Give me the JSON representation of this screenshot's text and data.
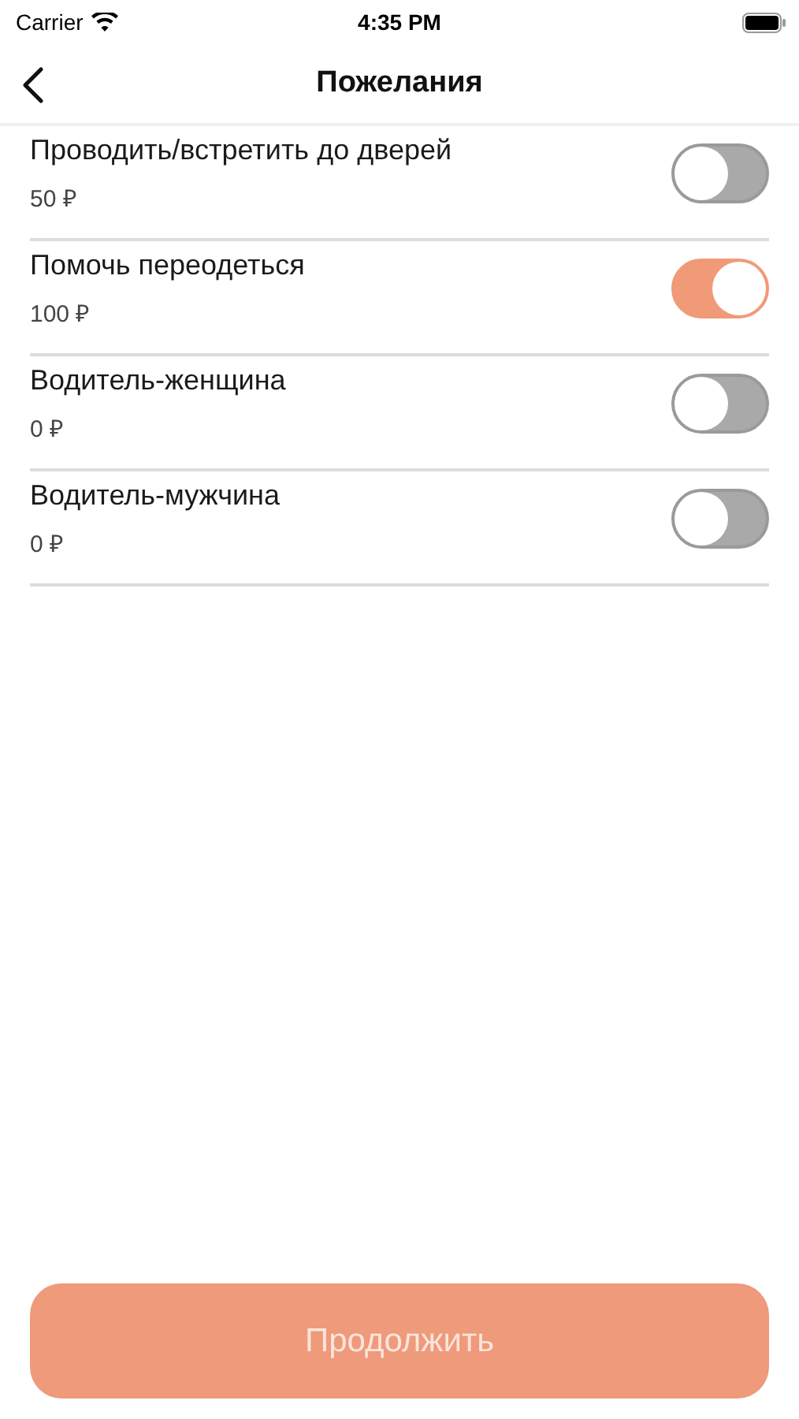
{
  "status_bar": {
    "carrier": "Carrier",
    "time": "4:35 PM"
  },
  "nav": {
    "title": "Пожелания"
  },
  "options": [
    {
      "label": "Проводить/встретить до дверей",
      "price": "50 ₽",
      "on": false
    },
    {
      "label": "Помочь переодеться",
      "price": "100 ₽",
      "on": true
    },
    {
      "label": "Водитель-женщина",
      "price": "0 ₽",
      "on": false
    },
    {
      "label": "Водитель-мужчина",
      "price": "0 ₽",
      "on": false
    }
  ],
  "continue_button": {
    "label": "Продолжить"
  }
}
